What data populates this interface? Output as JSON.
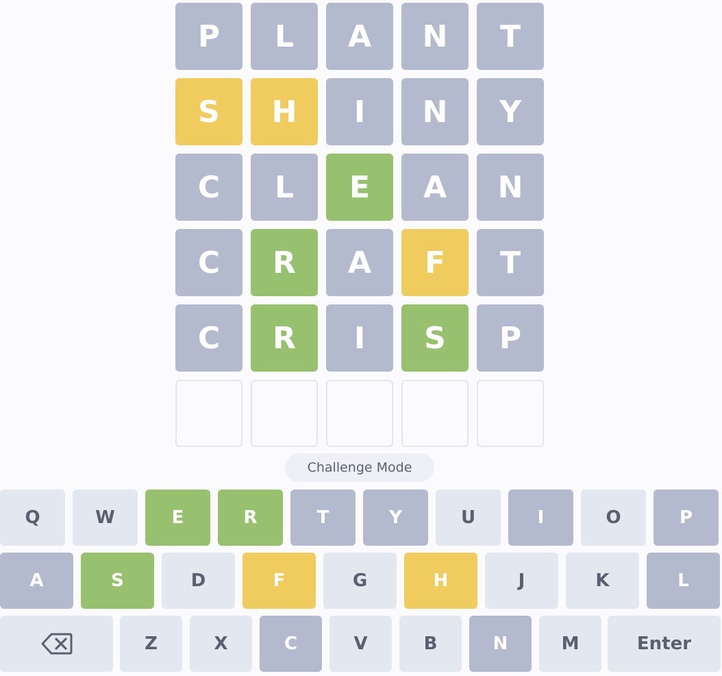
{
  "board": {
    "rows": [
      [
        {
          "letter": "P",
          "state": "absent"
        },
        {
          "letter": "L",
          "state": "absent"
        },
        {
          "letter": "A",
          "state": "absent"
        },
        {
          "letter": "N",
          "state": "absent"
        },
        {
          "letter": "T",
          "state": "absent"
        }
      ],
      [
        {
          "letter": "S",
          "state": "present"
        },
        {
          "letter": "H",
          "state": "present"
        },
        {
          "letter": "I",
          "state": "absent"
        },
        {
          "letter": "N",
          "state": "absent"
        },
        {
          "letter": "Y",
          "state": "absent"
        }
      ],
      [
        {
          "letter": "C",
          "state": "absent"
        },
        {
          "letter": "L",
          "state": "absent"
        },
        {
          "letter": "E",
          "state": "correct"
        },
        {
          "letter": "A",
          "state": "absent"
        },
        {
          "letter": "N",
          "state": "absent"
        }
      ],
      [
        {
          "letter": "C",
          "state": "absent"
        },
        {
          "letter": "R",
          "state": "correct"
        },
        {
          "letter": "A",
          "state": "absent"
        },
        {
          "letter": "F",
          "state": "present"
        },
        {
          "letter": "T",
          "state": "absent"
        }
      ],
      [
        {
          "letter": "C",
          "state": "absent"
        },
        {
          "letter": "R",
          "state": "correct"
        },
        {
          "letter": "I",
          "state": "absent"
        },
        {
          "letter": "S",
          "state": "correct"
        },
        {
          "letter": "P",
          "state": "absent"
        }
      ],
      [
        {
          "letter": "",
          "state": "empty"
        },
        {
          "letter": "",
          "state": "empty"
        },
        {
          "letter": "",
          "state": "empty"
        },
        {
          "letter": "",
          "state": "empty"
        },
        {
          "letter": "",
          "state": "empty"
        }
      ]
    ]
  },
  "mode_button": {
    "label": "Challenge Mode"
  },
  "keyboard": {
    "row1": [
      {
        "label": "Q",
        "state": "unused"
      },
      {
        "label": "W",
        "state": "unused"
      },
      {
        "label": "E",
        "state": "correct"
      },
      {
        "label": "R",
        "state": "correct"
      },
      {
        "label": "T",
        "state": "absent"
      },
      {
        "label": "Y",
        "state": "absent"
      },
      {
        "label": "U",
        "state": "unused"
      },
      {
        "label": "I",
        "state": "absent"
      },
      {
        "label": "O",
        "state": "unused"
      },
      {
        "label": "P",
        "state": "absent"
      }
    ],
    "row2": [
      {
        "label": "A",
        "state": "absent"
      },
      {
        "label": "S",
        "state": "correct"
      },
      {
        "label": "D",
        "state": "unused"
      },
      {
        "label": "F",
        "state": "present"
      },
      {
        "label": "G",
        "state": "unused"
      },
      {
        "label": "H",
        "state": "present"
      },
      {
        "label": "J",
        "state": "unused"
      },
      {
        "label": "K",
        "state": "unused"
      },
      {
        "label": "L",
        "state": "absent"
      }
    ],
    "row3": [
      {
        "label": "",
        "state": "unused",
        "icon": "backspace-icon"
      },
      {
        "label": "Z",
        "state": "unused"
      },
      {
        "label": "X",
        "state": "unused"
      },
      {
        "label": "C",
        "state": "absent"
      },
      {
        "label": "V",
        "state": "unused"
      },
      {
        "label": "B",
        "state": "unused"
      },
      {
        "label": "N",
        "state": "absent"
      },
      {
        "label": "M",
        "state": "unused"
      },
      {
        "label": "Enter",
        "state": "unused"
      }
    ]
  },
  "colors": {
    "absent": "#b4bacd",
    "present": "#f0cb5e",
    "correct": "#97c06f",
    "unused_key": "#e3e7ef",
    "key_text": "#5b6070",
    "background": "#fbfbfd"
  }
}
